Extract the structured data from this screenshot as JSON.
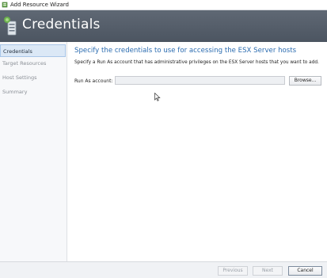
{
  "window": {
    "title": "Add Resource Wizard",
    "icon": "wizard-app-icon"
  },
  "header": {
    "title": "Credentials",
    "icon": "server-stack-icon"
  },
  "sidebar": {
    "items": [
      {
        "label": "Credentials",
        "active": true
      },
      {
        "label": "Target Resources",
        "active": false
      },
      {
        "label": "Host Settings",
        "active": false
      },
      {
        "label": "Summary",
        "active": false
      }
    ]
  },
  "main": {
    "heading": "Specify the credentials to use for accessing the ESX Server hosts",
    "description": "Specify a Run As account that has administrative privileges on the ESX Server hosts that you want to add.",
    "run_as_label": "Run As account:",
    "run_as_value": "",
    "browse_label": "Browse..."
  },
  "footer": {
    "previous_label": "Previous",
    "next_label": "Next",
    "cancel_label": "Cancel"
  },
  "colors": {
    "header_bg": "#555e6a",
    "heading_blue": "#2b6cb0",
    "active_nav_bg": "#dbe8f6"
  }
}
